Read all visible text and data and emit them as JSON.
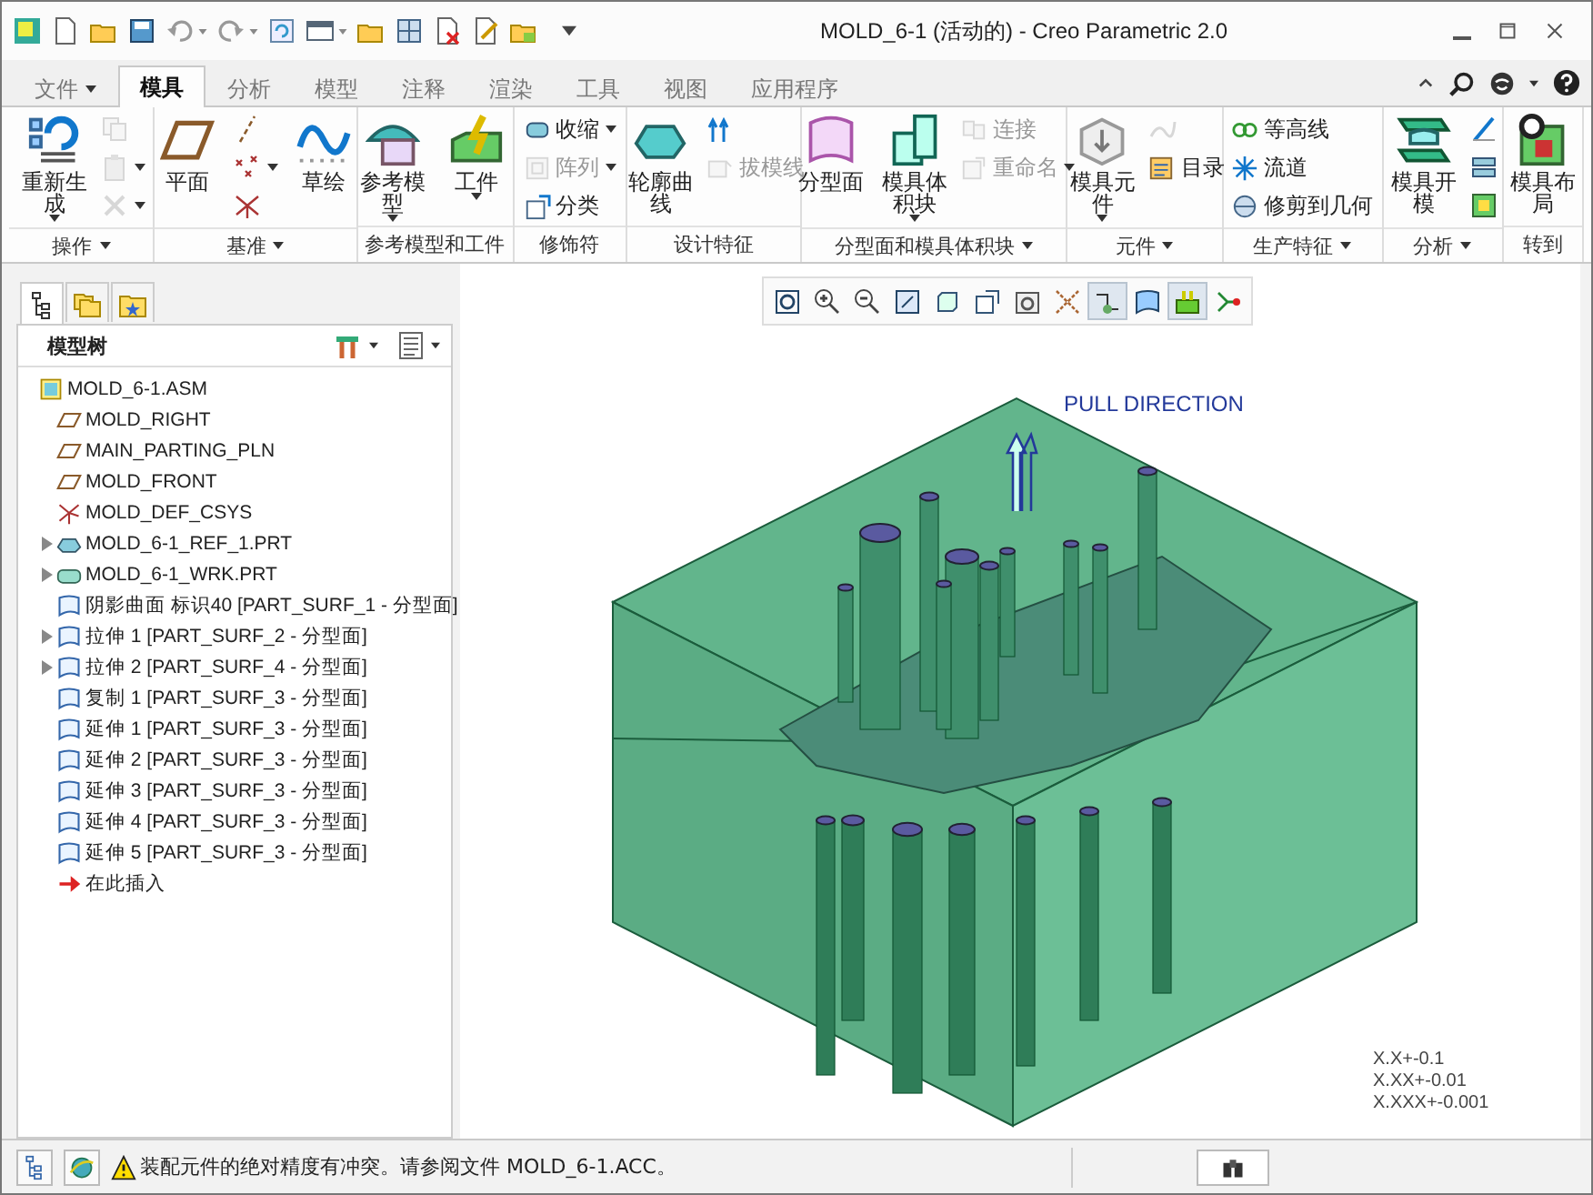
{
  "window": {
    "title": "MOLD_6-1 (活动的) - Creo Parametric 2.0"
  },
  "tabs": [
    {
      "label": "文件",
      "selected": false,
      "dropdown": true
    },
    {
      "label": "模具",
      "selected": true,
      "dropdown": false
    },
    {
      "label": "分析",
      "selected": false,
      "dropdown": false
    },
    {
      "label": "模型",
      "selected": false,
      "dropdown": false
    },
    {
      "label": "注释",
      "selected": false,
      "dropdown": false
    },
    {
      "label": "渲染",
      "selected": false,
      "dropdown": false
    },
    {
      "label": "工具",
      "selected": false,
      "dropdown": false
    },
    {
      "label": "视图",
      "selected": false,
      "dropdown": false
    },
    {
      "label": "应用程序",
      "selected": false,
      "dropdown": false
    }
  ],
  "ribbon": {
    "groups": [
      {
        "label": "操作",
        "dropdown": true,
        "items": [
          {
            "kind": "large",
            "label": "重新生成",
            "dropdown": true,
            "disabled": false
          },
          {
            "kind": "icon",
            "dropdown": false,
            "disabled": true
          },
          {
            "kind": "icon",
            "dropdown": true,
            "disabled": true
          },
          {
            "kind": "icon",
            "dropdown": true,
            "disabled": true
          }
        ]
      },
      {
        "label": "基准",
        "dropdown": true,
        "items": [
          {
            "kind": "large",
            "label": "平面",
            "dropdown": false,
            "disabled": false
          },
          {
            "kind": "icon",
            "dropdown": false,
            "disabled": false
          },
          {
            "kind": "icon",
            "dropdown": true,
            "disabled": false
          },
          {
            "kind": "icon",
            "dropdown": false,
            "disabled": false
          },
          {
            "kind": "large",
            "label": "草绘",
            "dropdown": false,
            "disabled": false
          }
        ]
      },
      {
        "label": "参考模型和工件",
        "dropdown": false,
        "items": [
          {
            "kind": "large",
            "label": "参考模型",
            "dropdown": true,
            "disabled": false
          },
          {
            "kind": "large",
            "label": "工件",
            "dropdown": true,
            "disabled": false
          }
        ]
      },
      {
        "label": "修饰符",
        "dropdown": false,
        "items": [
          {
            "kind": "small",
            "label": "收缩",
            "dropdown": true,
            "disabled": false
          },
          {
            "kind": "small",
            "label": "阵列",
            "dropdown": true,
            "disabled": true
          },
          {
            "kind": "small",
            "label": "分类",
            "dropdown": false,
            "disabled": false
          }
        ]
      },
      {
        "label": "设计特征",
        "dropdown": false,
        "items": [
          {
            "kind": "large",
            "label": "轮廓曲线",
            "dropdown": false,
            "disabled": false
          },
          {
            "kind": "icon",
            "dropdown": false,
            "disabled": false
          },
          {
            "kind": "small",
            "label": "拔模线",
            "dropdown": false,
            "disabled": true
          }
        ]
      },
      {
        "label": "分型面和模具体积块",
        "dropdown": true,
        "items": [
          {
            "kind": "large",
            "label": "分型面",
            "dropdown": false,
            "disabled": false
          },
          {
            "kind": "large",
            "label": "模具体积块",
            "dropdown": true,
            "disabled": false
          },
          {
            "kind": "small",
            "label": "连接",
            "dropdown": false,
            "disabled": true
          },
          {
            "kind": "small",
            "label": "重命名",
            "dropdown": true,
            "disabled": true
          }
        ]
      },
      {
        "label": "元件",
        "dropdown": true,
        "items": [
          {
            "kind": "large",
            "label": "模具元件",
            "dropdown": true,
            "disabled": false
          },
          {
            "kind": "icon",
            "dropdown": false,
            "disabled": true
          },
          {
            "kind": "small",
            "label": "目录",
            "dropdown": false,
            "disabled": false
          }
        ]
      },
      {
        "label": "生产特征",
        "dropdown": true,
        "items": [
          {
            "kind": "small",
            "label": "等高线",
            "dropdown": false,
            "disabled": false
          },
          {
            "kind": "small",
            "label": "流道",
            "dropdown": false,
            "disabled": false
          },
          {
            "kind": "small",
            "label": "修剪到几何",
            "dropdown": false,
            "disabled": false
          }
        ]
      },
      {
        "label": "分析",
        "dropdown": true,
        "items": [
          {
            "kind": "large",
            "label": "模具开模",
            "dropdown": false,
            "disabled": false
          },
          {
            "kind": "icon",
            "dropdown": false,
            "disabled": false
          },
          {
            "kind": "icon",
            "dropdown": false,
            "disabled": false
          },
          {
            "kind": "icon",
            "dropdown": false,
            "disabled": false
          }
        ]
      },
      {
        "label": "转到",
        "dropdown": false,
        "items": [
          {
            "kind": "large",
            "label": "模具布局",
            "dropdown": false,
            "disabled": false
          }
        ]
      }
    ]
  },
  "model_tree": {
    "navigator_tabs": [
      {
        "selected": true
      },
      {
        "selected": false
      },
      {
        "selected": false
      }
    ],
    "title": "模型树",
    "items": [
      {
        "kind": "assembly",
        "label": "MOLD_6-1.ASM",
        "expandable": false,
        "children": [
          {
            "kind": "plane",
            "label": "MOLD_RIGHT",
            "expandable": false
          },
          {
            "kind": "plane",
            "label": "MAIN_PARTING_PLN",
            "expandable": false
          },
          {
            "kind": "plane",
            "label": "MOLD_FRONT",
            "expandable": false
          },
          {
            "kind": "csys",
            "label": "MOLD_DEF_CSYS",
            "expandable": false
          },
          {
            "kind": "part",
            "label": "MOLD_6-1_REF_1.PRT",
            "expandable": true
          },
          {
            "kind": "workpiece",
            "label": "MOLD_6-1_WRK.PRT",
            "expandable": true
          },
          {
            "kind": "surface",
            "label": "阴影曲面 标识40 [PART_SURF_1 - 分型面]",
            "expandable": false
          },
          {
            "kind": "surface",
            "label": "拉伸 1 [PART_SURF_2 - 分型面]",
            "expandable": true
          },
          {
            "kind": "surface",
            "label": "拉伸 2 [PART_SURF_4 - 分型面]",
            "expandable": true
          },
          {
            "kind": "surface",
            "label": "复制 1 [PART_SURF_3 - 分型面]",
            "expandable": false
          },
          {
            "kind": "surface",
            "label": "延伸 1 [PART_SURF_3 - 分型面]",
            "expandable": false
          },
          {
            "kind": "surface",
            "label": "延伸 2 [PART_SURF_3 - 分型面]",
            "expandable": false
          },
          {
            "kind": "surface",
            "label": "延伸 3 [PART_SURF_3 - 分型面]",
            "expandable": false
          },
          {
            "kind": "surface",
            "label": "延伸 4 [PART_SURF_3 - 分型面]",
            "expandable": false
          },
          {
            "kind": "surface",
            "label": "延伸 5 [PART_SURF_3 - 分型面]",
            "expandable": false
          },
          {
            "kind": "insert",
            "label": "在此插入",
            "expandable": false
          }
        ]
      }
    ]
  },
  "graphics": {
    "view_toolbar": [
      {
        "selected": false
      },
      {
        "selected": false
      },
      {
        "selected": false
      },
      {
        "selected": false
      },
      {
        "selected": false
      },
      {
        "selected": false
      },
      {
        "selected": false
      },
      {
        "selected": false
      },
      {
        "selected": true
      },
      {
        "selected": false
      },
      {
        "selected": true
      },
      {
        "selected": false
      }
    ],
    "pull_direction_label": "PULL DIRECTION",
    "tolerances": [
      "X.X+-0.1",
      "X.XX+-0.01",
      "X.XXX+-0.001"
    ]
  },
  "status_bar": {
    "message": "装配元件的绝对精度有冲突。请参阅文件 MOLD_6-1.ACC。"
  }
}
